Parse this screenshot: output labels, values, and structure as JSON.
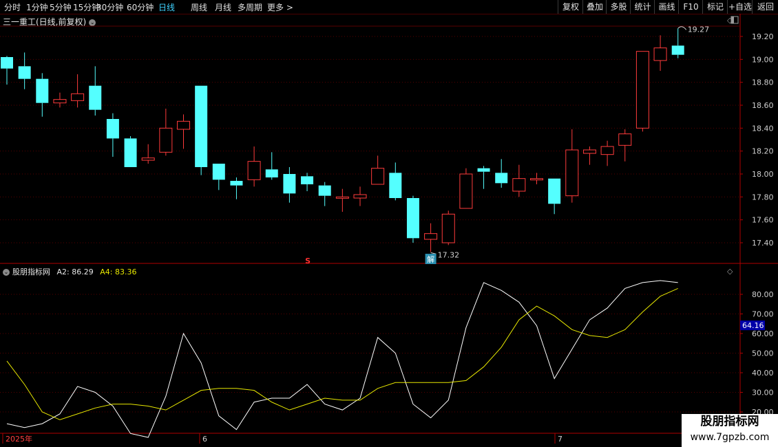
{
  "toolbar": {
    "periods": [
      "分时",
      "1分钟",
      "5分钟",
      "15分钟",
      "30分钟",
      "60分钟",
      "日线",
      "周线",
      "月线",
      "多周期",
      "更多 >"
    ],
    "active_period": "日线",
    "right_buttons": [
      "复权",
      "叠加",
      "多股",
      "统计",
      "画线",
      "F10",
      "标记",
      "+自选",
      "返回"
    ]
  },
  "main_title": "三一重工(日线,前复权)",
  "colors": {
    "up": "#ff3b3b",
    "down": "#54ffff",
    "grid": "#5a0000",
    "axis": "#b00000",
    "line_white": "#ffffff",
    "line_yellow": "#e8e800",
    "highlight_box": "#0000a8"
  },
  "icons": {
    "dropdown": "chevron-down-icon",
    "settings": "settings-icon"
  },
  "indicator": {
    "name": "股朋指标网",
    "a2_label": "A2:",
    "a2_value": "86.29",
    "a4_label": "A4:",
    "a4_value": "83.36",
    "current_value_box": "64.16"
  },
  "markers": {
    "s_marker": "S",
    "jie_marker": "解"
  },
  "watermark": {
    "title": "股朋指标网",
    "url": "www.7gpzb.com"
  },
  "chart_data": [
    {
      "type": "candlestick",
      "title": "三一重工(日线,前复权)",
      "ylim": [
        17.3,
        19.3
      ],
      "yticks": [
        "19.20",
        "19.00",
        "18.80",
        "18.60",
        "18.40",
        "18.20",
        "18.00",
        "17.80",
        "17.60",
        "17.40"
      ],
      "annotations": [
        {
          "text": "19.27",
          "value": 19.27
        },
        {
          "text": "17.32",
          "value": 17.32
        }
      ],
      "candles": [
        {
          "o": 19.02,
          "c": 18.92,
          "h": 19.03,
          "l": 18.78
        },
        {
          "o": 18.94,
          "c": 18.83,
          "h": 19.06,
          "l": 18.74
        },
        {
          "o": 18.83,
          "c": 18.62,
          "h": 18.88,
          "l": 18.5
        },
        {
          "o": 18.62,
          "c": 18.65,
          "h": 18.71,
          "l": 18.58
        },
        {
          "o": 18.64,
          "c": 18.7,
          "h": 18.87,
          "l": 18.58
        },
        {
          "o": 18.77,
          "c": 18.56,
          "h": 18.94,
          "l": 18.51
        },
        {
          "o": 18.48,
          "c": 18.31,
          "h": 18.53,
          "l": 18.15
        },
        {
          "o": 18.31,
          "c": 18.06,
          "h": 18.33,
          "l": 18.06
        },
        {
          "o": 18.12,
          "c": 18.14,
          "h": 18.26,
          "l": 18.09
        },
        {
          "o": 18.19,
          "c": 18.4,
          "h": 18.57,
          "l": 18.16
        },
        {
          "o": 18.39,
          "c": 18.46,
          "h": 18.52,
          "l": 18.22
        },
        {
          "o": 18.77,
          "c": 18.06,
          "h": 18.77,
          "l": 17.99
        },
        {
          "o": 18.09,
          "c": 17.95,
          "h": 18.09,
          "l": 17.86
        },
        {
          "o": 17.94,
          "c": 17.9,
          "h": 17.97,
          "l": 17.78
        },
        {
          "o": 17.95,
          "c": 18.11,
          "h": 18.24,
          "l": 17.89
        },
        {
          "o": 18.04,
          "c": 17.97,
          "h": 18.19,
          "l": 17.95
        },
        {
          "o": 18.0,
          "c": 17.83,
          "h": 18.06,
          "l": 17.75
        },
        {
          "o": 17.98,
          "c": 17.91,
          "h": 18.01,
          "l": 17.85
        },
        {
          "o": 17.9,
          "c": 17.81,
          "h": 17.93,
          "l": 17.72
        },
        {
          "o": 17.79,
          "c": 17.8,
          "h": 17.87,
          "l": 17.67
        },
        {
          "o": 17.79,
          "c": 17.82,
          "h": 17.89,
          "l": 17.72
        },
        {
          "o": 17.91,
          "c": 18.05,
          "h": 18.16,
          "l": 17.91
        },
        {
          "o": 18.01,
          "c": 17.79,
          "h": 18.1,
          "l": 17.77
        },
        {
          "o": 17.79,
          "c": 17.44,
          "h": 17.81,
          "l": 17.4
        },
        {
          "o": 17.43,
          "c": 17.48,
          "h": 17.57,
          "l": 17.32
        },
        {
          "o": 17.4,
          "c": 17.65,
          "h": 17.68,
          "l": 17.38
        },
        {
          "o": 17.7,
          "c": 18.0,
          "h": 18.05,
          "l": 17.7
        },
        {
          "o": 18.05,
          "c": 18.02,
          "h": 18.07,
          "l": 17.87
        },
        {
          "o": 18.01,
          "c": 17.92,
          "h": 18.13,
          "l": 17.88
        },
        {
          "o": 17.85,
          "c": 17.96,
          "h": 18.08,
          "l": 17.8
        },
        {
          "o": 17.95,
          "c": 17.96,
          "h": 18.01,
          "l": 17.91
        },
        {
          "o": 17.96,
          "c": 17.74,
          "h": 17.96,
          "l": 17.65
        },
        {
          "o": 17.81,
          "c": 18.21,
          "h": 18.39,
          "l": 17.75
        },
        {
          "o": 18.18,
          "c": 18.21,
          "h": 18.24,
          "l": 18.08
        },
        {
          "o": 18.17,
          "c": 18.24,
          "h": 18.29,
          "l": 18.07
        },
        {
          "o": 18.25,
          "c": 18.35,
          "h": 18.39,
          "l": 18.11
        },
        {
          "o": 18.4,
          "c": 19.07,
          "h": 19.07,
          "l": 18.37
        },
        {
          "o": 18.99,
          "c": 19.1,
          "h": 19.21,
          "l": 18.9
        },
        {
          "o": 19.12,
          "c": 19.04,
          "h": 19.27,
          "l": 19.01
        }
      ]
    },
    {
      "type": "line",
      "title": "股朋指标网",
      "ylim": [
        20,
        90
      ],
      "yticks": [
        "80.00",
        "70.00",
        "60.00",
        "50.00",
        "40.00",
        "30.00",
        "20.00"
      ],
      "x_labels": [
        "2025年",
        "6",
        "7"
      ],
      "series": [
        {
          "name": "A2",
          "color": "#ffffff",
          "values": [
            14,
            12,
            14,
            19,
            33,
            30,
            23,
            9,
            7,
            28,
            60,
            45,
            18,
            11,
            25,
            27,
            27,
            34,
            24,
            21,
            27,
            58,
            50,
            24,
            17,
            26,
            63,
            86,
            82,
            76,
            64,
            37,
            52,
            67,
            73,
            83,
            86,
            87,
            86
          ]
        },
        {
          "name": "A4",
          "color": "#e8e800",
          "values": [
            46,
            34,
            20,
            16,
            19,
            22,
            24,
            24,
            23,
            21,
            26,
            31,
            32,
            32,
            31,
            25,
            21,
            24,
            27,
            26,
            26,
            32,
            35,
            35,
            35,
            35,
            36,
            43,
            53,
            67,
            74,
            69,
            62,
            59,
            58,
            62,
            71,
            79,
            83
          ]
        }
      ]
    }
  ]
}
